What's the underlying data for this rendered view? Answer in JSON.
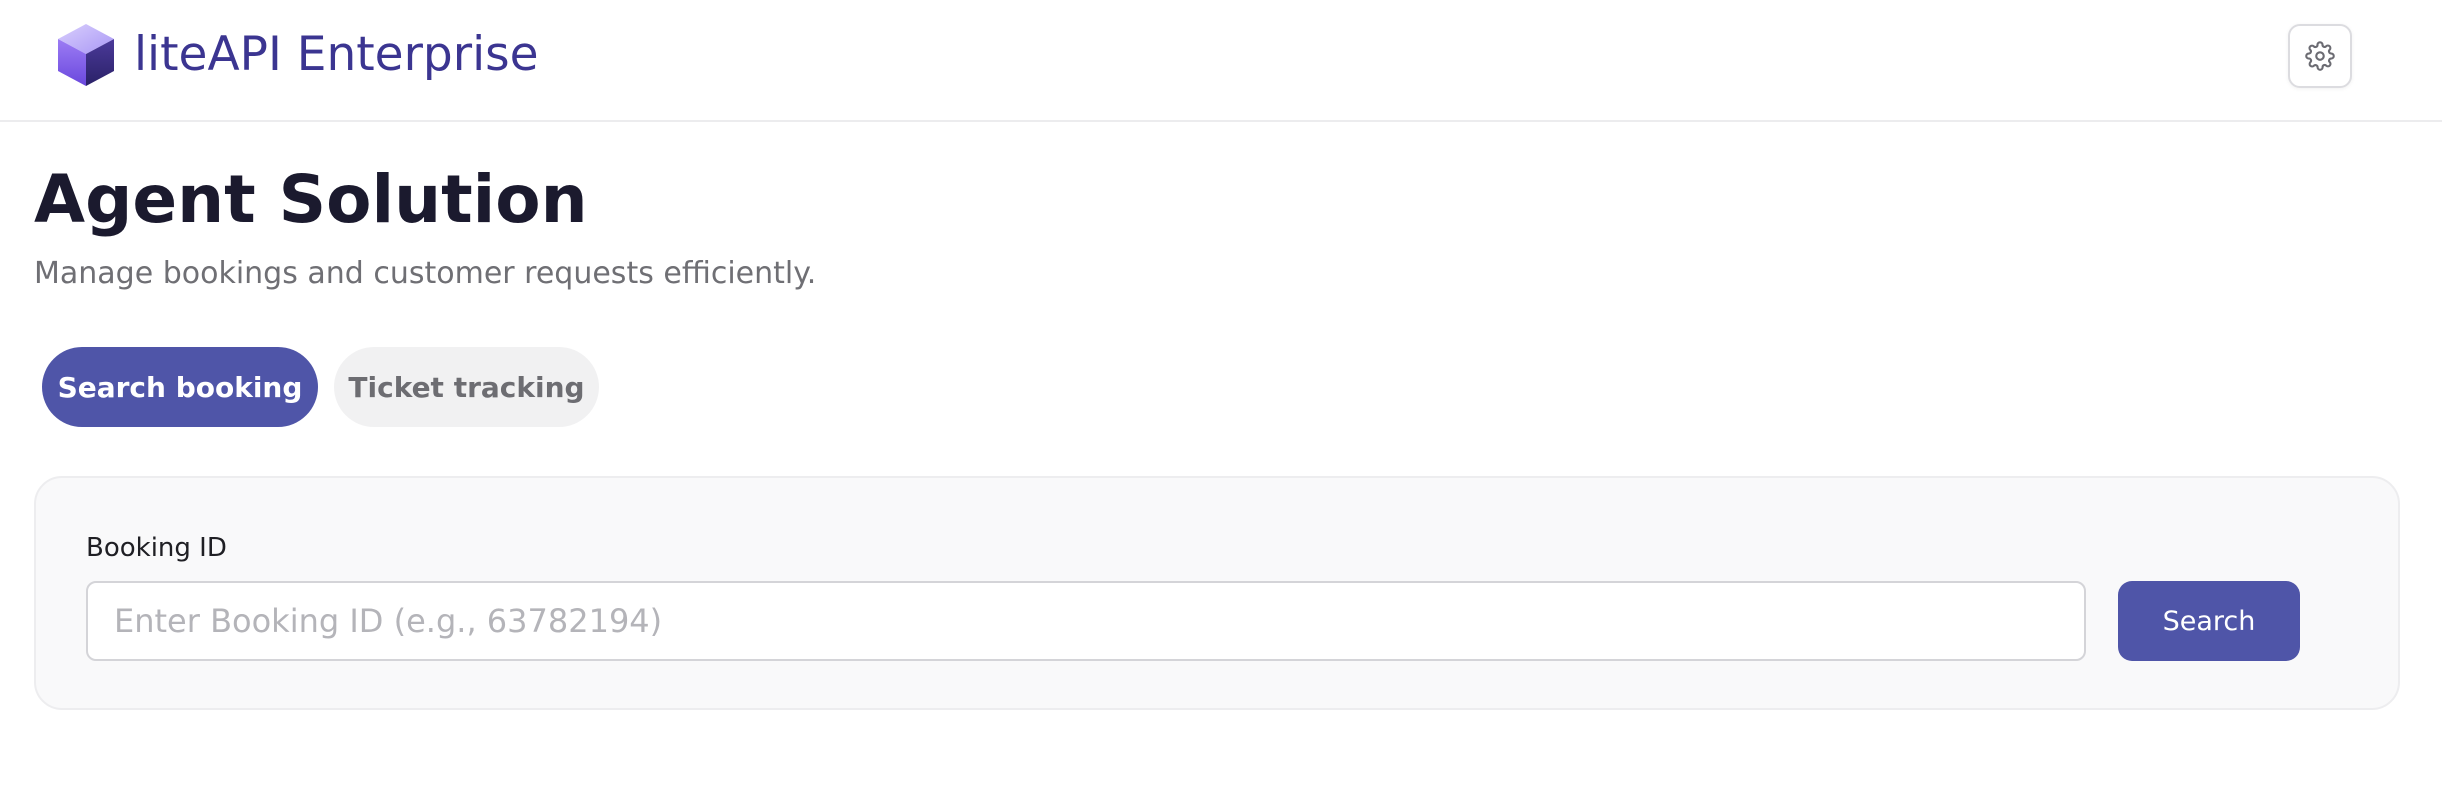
{
  "header": {
    "brand": "liteAPI Enterprise",
    "logo_icon": "cube-logo-icon",
    "settings_icon": "gear-icon"
  },
  "main": {
    "title": "Agent Solution",
    "subtitle": "Manage bookings and customer requests efficiently.",
    "tabs": [
      {
        "label": "Search booking",
        "active": true
      },
      {
        "label": "Ticket tracking",
        "active": false
      }
    ],
    "search_form": {
      "label": "Booking ID",
      "input_value": "",
      "placeholder": "Enter Booking ID (e.g., 63782194)",
      "button_label": "Search"
    }
  },
  "colors": {
    "accent": "#4f55a8",
    "brand_text": "#3b3591",
    "title_text": "#1b1a2e",
    "muted_text": "#6f6f74",
    "inactive_tab_bg": "#f1f1f2",
    "card_bg": "#f9f9fa"
  }
}
